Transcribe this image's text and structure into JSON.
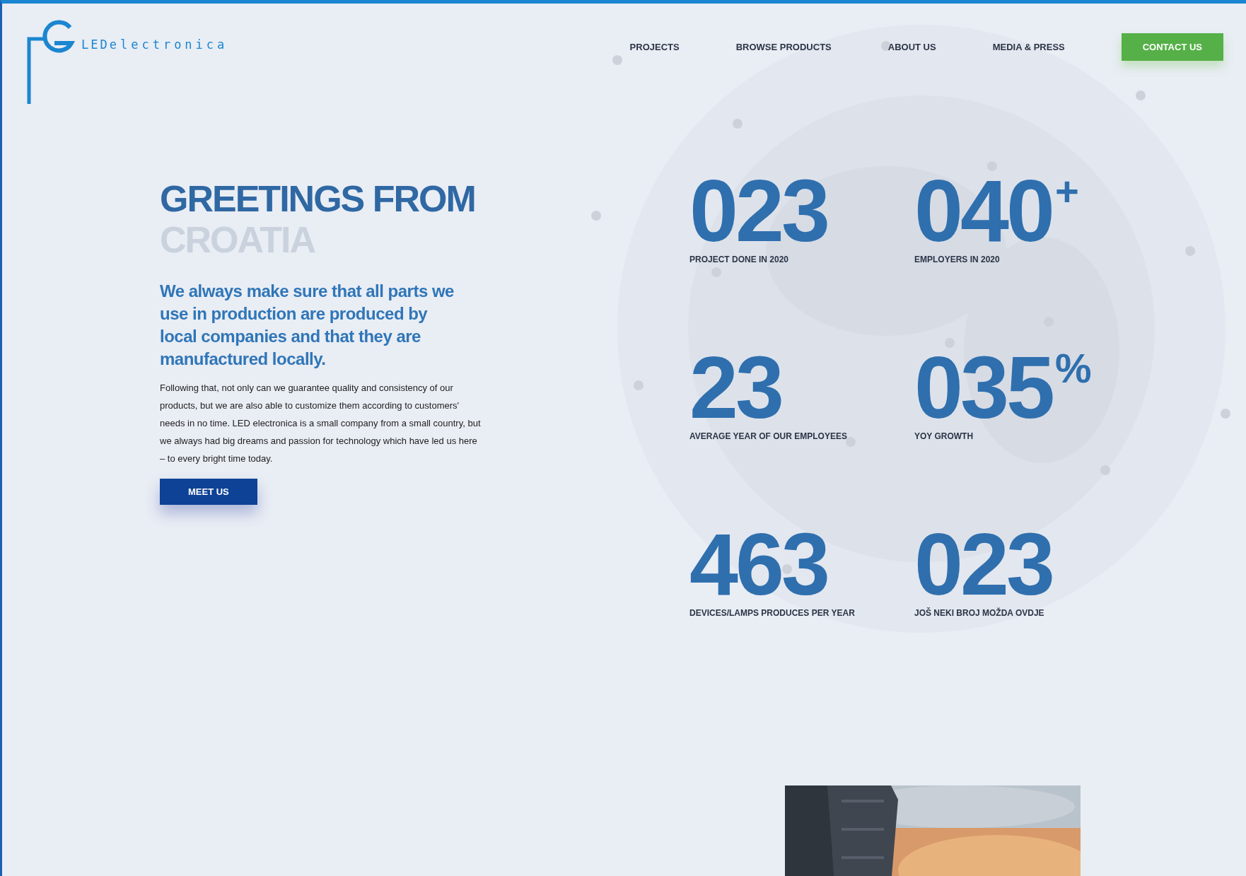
{
  "brand": {
    "name_prefix": "LED",
    "name_rest": "electronica"
  },
  "nav": [
    {
      "label": "PROJECTS"
    },
    {
      "label": "BROWSE PRODUCTS"
    },
    {
      "label": "ABOUT US"
    },
    {
      "label": "MEDIA & PRESS"
    }
  ],
  "contact_button": "CONTACT US",
  "hero": {
    "title_line1": "GREETINGS FROM",
    "title_line2": "CROATIA",
    "lead": "We always make sure that all parts we use in production are produced by local companies and that they are manufactured locally.",
    "body": "Following that, not only can we guarantee quality and consistency of our products, but we are also able to customize them according to customers' needs in no time. LED electronica is a small company from a small country, but we always had big dreams and passion for technology which have led us here – to every bright time today.",
    "button": "MEET US"
  },
  "stats": [
    {
      "value": "023",
      "label": "PROJECT DONE IN 2020"
    },
    {
      "value": "040",
      "suffix": "+",
      "label": "EMPLOYERS IN 2020"
    },
    {
      "value": "23",
      "label": "AVERAGE YEAR OF OUR EMPLOYEES"
    },
    {
      "value": "035",
      "suffix": "%",
      "label": "YOY GROWTH"
    },
    {
      "value": "463",
      "label": "DEVICES/LAMPS PRODUCES PER YEAR"
    },
    {
      "value": "023",
      "label": "JOŠ NEKI BROJ MOŽDA OVDJE"
    }
  ]
}
